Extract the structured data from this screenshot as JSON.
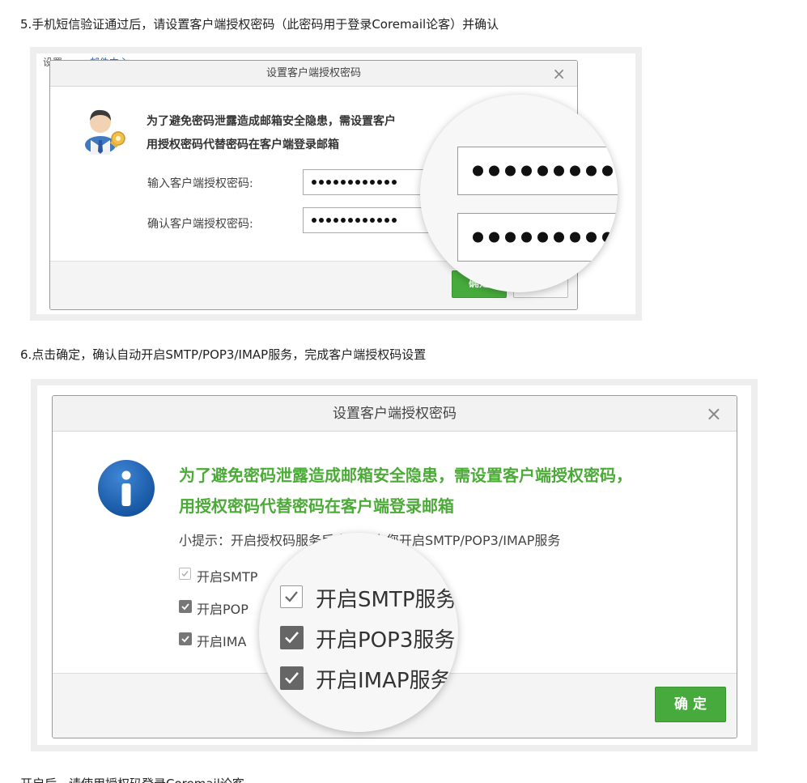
{
  "step5": {
    "text": "5.手机短信验证通过后，请设置客户端授权密码（此密码用于登录Coremail论客）并确认",
    "behind_tab": "设置",
    "behind_tab2": "邮件中心",
    "dialog": {
      "title": "设置客户端授权密码",
      "close": "×",
      "message_line1": "为了避免密码泄露造成邮箱安全隐患，需设置客户",
      "message_line2": "用授权密码代替密码在客户端登录邮箱",
      "label_input": "输入客户端授权密码:",
      "label_confirm": "确认客户端授权密码:",
      "ok_label": "确定"
    }
  },
  "step6": {
    "text": "6.点击确定，确认自动开启SMTP/POP3/IMAP服务，完成客户端授权码设置",
    "dialog": {
      "title": "设置客户端授权密码",
      "close": "×",
      "message_line1": "为了避免密码泄露造成邮箱安全隐患，需设置客户端授权密码，",
      "message_line2": "用授权密码代替密码在客户端登录邮箱",
      "tip": "小提示：开启授权码服务后会自动为您开启SMTP/POP3/IMAP服务",
      "checkboxes": [
        {
          "label": "开启SMTP",
          "checked": true
        },
        {
          "label": "开启POP",
          "checked": true
        },
        {
          "label": "开启IMA",
          "checked": true
        }
      ],
      "zoom_checkboxes": [
        {
          "label": "开启SMTP服务",
          "checked": true
        },
        {
          "label": "开启POP3服务",
          "checked": true
        },
        {
          "label": "开启IMAP服务",
          "checked": true
        }
      ],
      "ok_label": "确 定"
    }
  },
  "step7": {
    "text": "开启后，请使用授权码登录Coremail论客"
  },
  "colors": {
    "accent_green": "#46ab3c",
    "message_green": "#4caa38",
    "info_blue": "#1f62b5"
  }
}
